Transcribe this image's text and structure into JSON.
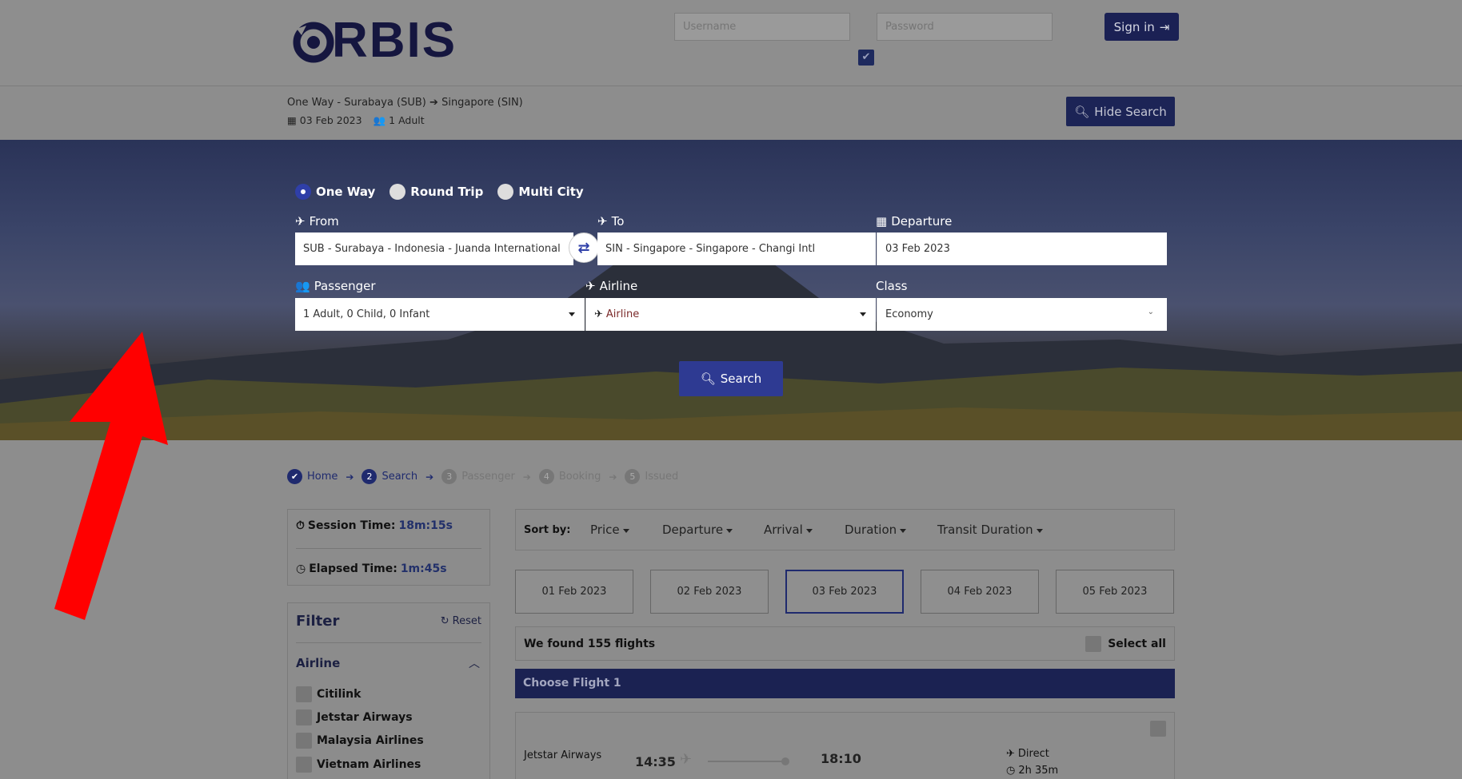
{
  "header": {
    "logo_text": "RBIS",
    "username_placeholder": "Username",
    "password_placeholder": "Password",
    "signin_label": "Sign in"
  },
  "summary": {
    "route_prefix": "One Way - Surabaya (SUB)",
    "route_suffix": "Singapore (SIN)",
    "date": "03 Feb 2023",
    "passengers": "1 Adult",
    "hide_label": "Hide Search"
  },
  "search": {
    "trip_types": [
      "One Way",
      "Round Trip",
      "Multi City"
    ],
    "selected_trip": "One Way",
    "from_label": "From",
    "from_value": "SUB - Surabaya - Indonesia - Juanda International",
    "to_label": "To",
    "to_value": "SIN - Singapore - Singapore - Changi Intl",
    "departure_label": "Departure",
    "departure_value": "03 Feb 2023",
    "passenger_label": "Passenger",
    "passenger_value": "1 Adult, 0 Child, 0 Infant",
    "airline_label": "Airline",
    "airline_value": "Airline",
    "class_label": "Class",
    "class_value": "Economy",
    "search_label": "Search"
  },
  "steps": [
    {
      "num": "",
      "label": "Home",
      "active": true
    },
    {
      "num": "2",
      "label": "Search",
      "active": true
    },
    {
      "num": "3",
      "label": "Passenger",
      "active": false
    },
    {
      "num": "4",
      "label": "Booking",
      "active": false
    },
    {
      "num": "5",
      "label": "Issued",
      "active": false
    }
  ],
  "session": {
    "session_label": "Session Time:",
    "session_value": "18m:15s",
    "elapsed_label": "Elapsed Time:",
    "elapsed_value": "1m:45s"
  },
  "filter": {
    "title": "Filter",
    "reset_label": "Reset",
    "section": "Airline",
    "airlines": [
      "Citilink",
      "Jetstar Airways",
      "Malaysia Airlines",
      "Vietnam Airlines"
    ]
  },
  "sort": {
    "label": "Sort by:",
    "options": [
      "Price",
      "Departure",
      "Arrival",
      "Duration",
      "Transit Duration"
    ]
  },
  "dates": [
    "01 Feb 2023",
    "02 Feb 2023",
    "03 Feb 2023",
    "04 Feb 2023",
    "05 Feb 2023"
  ],
  "selected_date": "03 Feb 2023",
  "results": {
    "found_text": "We found 155 flights",
    "select_all": "Select all",
    "choose_title": "Choose Flight 1"
  },
  "flight": {
    "airline": "Jetstar Airways",
    "depart": "14:35",
    "arrive": "18:10",
    "stops": "Direct",
    "duration": "2h 35m"
  },
  "colors": {
    "brand": "#1b2154",
    "accent": "#2e3a92",
    "annotation_arrow": "#ff0000"
  }
}
